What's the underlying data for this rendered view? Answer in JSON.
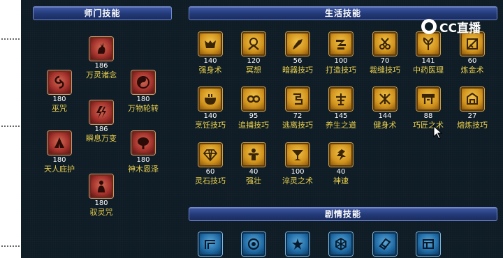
{
  "sect_skills": {
    "header": "师门技能",
    "items": [
      {
        "level": "186",
        "name": "万灵诸念",
        "icon": "rabbit-icon"
      },
      {
        "level": "180",
        "name": "巫咒",
        "icon": "swirl-icon"
      },
      {
        "level": "180",
        "name": "万物轮转",
        "icon": "yinyang-icon"
      },
      {
        "level": "186",
        "name": "瞬息万变",
        "icon": "lightning-icon"
      },
      {
        "level": "180",
        "name": "天人庇护",
        "icon": "praying-hands-icon"
      },
      {
        "level": "180",
        "name": "神木恩泽",
        "icon": "tree-icon"
      },
      {
        "level": "180",
        "name": "驭灵咒",
        "icon": "spirit-figure-icon"
      }
    ]
  },
  "life_skills": {
    "header": "生活技能",
    "items": [
      {
        "level": "140",
        "name": "强身术",
        "icon": "strength-icon"
      },
      {
        "level": "120",
        "name": "冥想",
        "icon": "meditate-icon"
      },
      {
        "level": "56",
        "name": "暗器技巧",
        "icon": "dart-icon"
      },
      {
        "level": "100",
        "name": "打造技巧",
        "icon": "anvil-icon"
      },
      {
        "level": "70",
        "name": "裁缝技巧",
        "icon": "scissors-icon"
      },
      {
        "level": "141",
        "name": "中药医理",
        "icon": "herb-icon"
      },
      {
        "level": "60",
        "name": "炼金术",
        "icon": "alchemy-icon"
      },
      {
        "level": "140",
        "name": "烹饪技巧",
        "icon": "cooking-icon"
      },
      {
        "level": "95",
        "name": "追捕技巧",
        "icon": "rope-icon"
      },
      {
        "level": "72",
        "name": "逃离技巧",
        "icon": "escape-icon"
      },
      {
        "level": "145",
        "name": "养生之道",
        "icon": "health-icon"
      },
      {
        "level": "144",
        "name": "健身术",
        "icon": "fitness-icon"
      },
      {
        "level": "88",
        "name": "巧匠之术",
        "icon": "craftsman-icon"
      },
      {
        "level": "27",
        "name": "熔炼技巧",
        "icon": "smelting-icon"
      },
      {
        "level": "60",
        "name": "灵石技巧",
        "icon": "gem-icon"
      },
      {
        "level": "40",
        "name": "强壮",
        "icon": "muscle-icon"
      },
      {
        "level": "100",
        "name": "淬灵之术",
        "icon": "tempering-icon"
      },
      {
        "level": "40",
        "name": "神速",
        "icon": "speed-icon"
      }
    ]
  },
  "story_skills": {
    "header": "剧情技能",
    "items": [
      {
        "icon": "story-skill-1-icon"
      },
      {
        "icon": "story-skill-2-icon"
      },
      {
        "icon": "story-skill-3-icon"
      },
      {
        "icon": "story-skill-4-icon"
      },
      {
        "icon": "story-skill-5-icon"
      },
      {
        "icon": "story-skill-6-icon"
      }
    ]
  },
  "watermark": {
    "text": "CC直播"
  },
  "colors": {
    "panel_bg": "#0e1c26",
    "header_blue": "#2c4488",
    "skill_name": "#e9cf4c",
    "skill_level": "#ffffff"
  }
}
